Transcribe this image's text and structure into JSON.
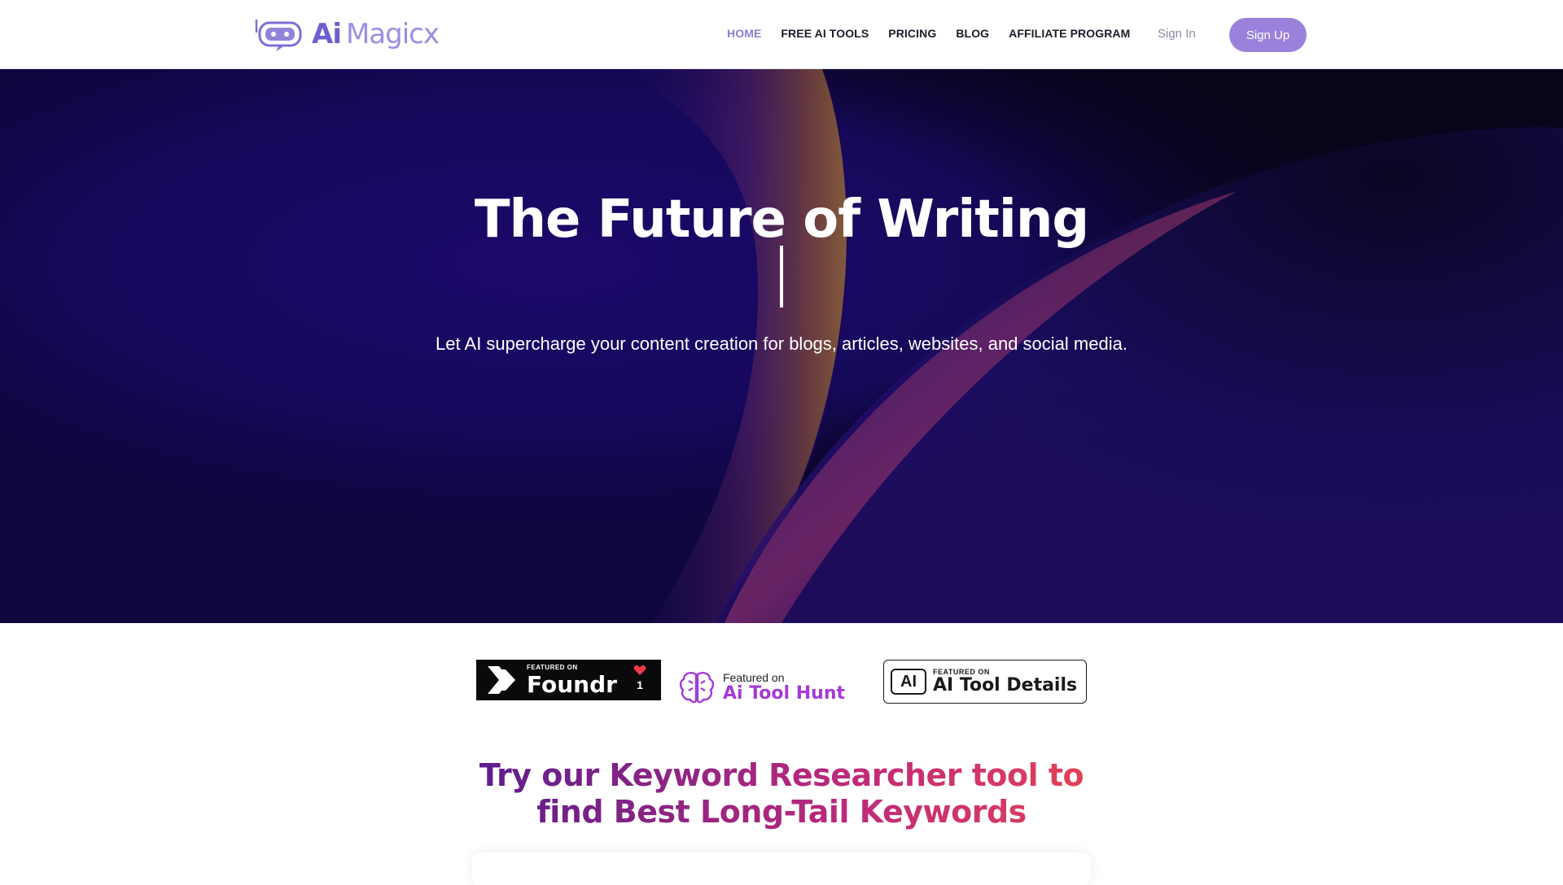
{
  "brand": {
    "logo_ai": "Ai",
    "logo_name": "Magicx",
    "accent_color": "#9a82dc"
  },
  "nav": {
    "links": [
      {
        "label": "HOME",
        "active": true
      },
      {
        "label": "FREE AI TOOLS",
        "active": false
      },
      {
        "label": "PRICING",
        "active": false
      },
      {
        "label": "BLOG",
        "active": false
      },
      {
        "label": "AFFILIATE PROGRAM",
        "active": false
      }
    ],
    "sign_in": "Sign In",
    "sign_up": "Sign Up"
  },
  "hero": {
    "title": "The Future of Writing",
    "subtitle": "Let AI supercharge your content creation for blogs, articles, websites, and social media."
  },
  "badges": {
    "foundr": {
      "small": "FEATURED ON",
      "name": "Foundr",
      "count": "1",
      "icon": "heart-icon"
    },
    "hunt": {
      "small": "Featured on",
      "name": "Ai Tool Hunt",
      "icon": "brain-icon"
    },
    "details": {
      "small": "FEATURED ON",
      "name": "AI Tool Details",
      "mark": "AI"
    }
  },
  "keyword_section": {
    "line1": "Try our Keyword Researcher tool to",
    "line2": "find Best Long-Tail Keywords"
  }
}
